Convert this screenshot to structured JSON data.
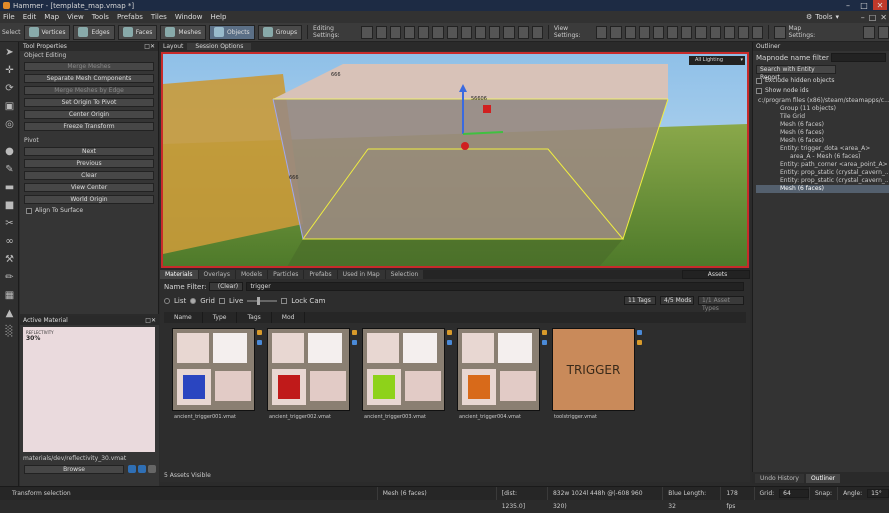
{
  "window": {
    "title": "Hammer - [template_map.vmap *]"
  },
  "menu": [
    "File",
    "Edit",
    "Map",
    "View",
    "Tools",
    "Prefabs",
    "Tiles",
    "Window",
    "Help"
  ],
  "tools_menu": "Tools",
  "toolbar": {
    "select_label": "Select",
    "modes": [
      "Vertices",
      "Edges",
      "Faces",
      "Meshes",
      "Objects",
      "Groups"
    ],
    "editing_settings": "Editing Settings:",
    "view_settings": "View Settings:",
    "map_settings": "Map Settings:"
  },
  "toolprops": {
    "title": "Tool Properties",
    "object_editing": "Object Editing",
    "buttons": [
      "Merge Meshes",
      "Separate Mesh Components",
      "Merge Meshes by Edge",
      "Set Origin To Pivot",
      "Center Origin",
      "Freeze Transform"
    ],
    "pivot_label": "Pivot",
    "pivot_buttons": [
      "Next",
      "Previous",
      "Clear",
      "View Center",
      "World Origin"
    ],
    "align_label": "Align To Surface"
  },
  "active_material": {
    "title": "Active Material",
    "preview_line1": "REFLECTIVITY",
    "preview_line2": "30%",
    "name": "materials/dev/reflectivity_30.vmat",
    "browse": "Browse"
  },
  "viewport": {
    "layout_tab": "Layout",
    "session_tab": "Session Options",
    "lighting": "All Lighting",
    "labels": [
      "666",
      "56606",
      "666"
    ]
  },
  "assets": {
    "tabs": [
      "Materials",
      "Overlays",
      "Models",
      "Particles",
      "Prefabs",
      "Used in Map",
      "Selection"
    ],
    "dropdown": "Assets",
    "name_filter_label": "Name Filter:",
    "clear_btn": "(Clear)",
    "filter_value": "trigger",
    "view_list": "List",
    "view_grid": "Grid",
    "live": "Live",
    "lock_cam": "Lock Cam",
    "tags_btn": "11 Tags",
    "mods_btn": "4/5 Mods",
    "asset_types": "1/1 Asset Types",
    "columns": [
      "Name",
      "Type",
      "Tags",
      "Mod"
    ],
    "items": [
      {
        "name": "ancient_trigger001.vmat",
        "color": "#2a45c0"
      },
      {
        "name": "ancient_trigger002.vmat",
        "color": "#c01a1a"
      },
      {
        "name": "ancient_trigger003.vmat",
        "color": "#8ed21a"
      },
      {
        "name": "ancient_trigger004.vmat",
        "color": "#d86a1a"
      },
      {
        "name": "toolstrigger.vmat",
        "color": "#c98a5a",
        "label": "TRIGGER"
      }
    ],
    "footer": "5 Assets Visible"
  },
  "outliner": {
    "title": "Outliner",
    "mapnode_label": "Mapnode name filter",
    "search_entity": "Search with Entity Report",
    "exclude_hidden": "Exclude hidden objects",
    "show_node_ids": "Show node ids",
    "items": [
      {
        "text": "c:/program files (x86)/steam/steamapps/c...",
        "indent": 0,
        "sel": false
      },
      {
        "text": "Group (11 objects)",
        "indent": 1,
        "sel": false
      },
      {
        "text": "Tile Grid",
        "indent": 1,
        "sel": false
      },
      {
        "text": "Mesh (6 faces)",
        "indent": 1,
        "sel": false
      },
      {
        "text": "Mesh (6 faces)",
        "indent": 1,
        "sel": false
      },
      {
        "text": "Mesh (6 faces)",
        "indent": 1,
        "sel": false
      },
      {
        "text": "Entity: trigger_dota <area_A>",
        "indent": 1,
        "sel": false
      },
      {
        "text": "area_A - Mesh (6 faces)",
        "indent": 2,
        "sel": false
      },
      {
        "text": "Entity: path_corner <area_point_A>",
        "indent": 1,
        "sel": false
      },
      {
        "text": "Entity: prop_static (crystal_cavern_...",
        "indent": 1,
        "sel": false
      },
      {
        "text": "Entity: prop_static (crystal_cavern_...",
        "indent": 1,
        "sel": false
      },
      {
        "text": "Mesh (6 faces)",
        "indent": 1,
        "sel": true
      }
    ],
    "bottom_tabs": [
      "Undo History",
      "Outliner"
    ]
  },
  "status": {
    "left": "Transform selection",
    "selection": "Mesh (6 faces)",
    "dist": "[dist: 1235.0]",
    "dims": "832w 1024l 448h @(-608 960 320)",
    "blue_length": "Blue Length: 32",
    "fps": "178 fps",
    "grid_label": "Grid:",
    "grid_value": "64",
    "snap": "Snap:",
    "angle_label": "Angle:",
    "angle_value": "15°"
  }
}
